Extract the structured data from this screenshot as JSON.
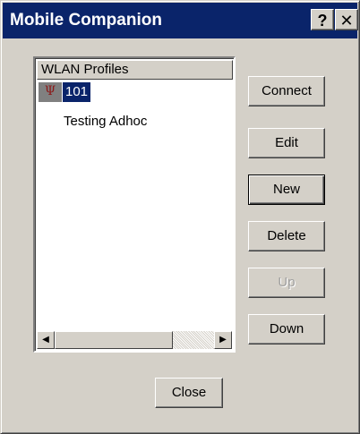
{
  "window": {
    "title": "Mobile Companion",
    "help_label": "?",
    "close_label": "✕"
  },
  "profiles": {
    "header": "WLAN Profiles",
    "items": [
      {
        "label": "101",
        "selected": true,
        "icon": "antenna-icon",
        "icon_glyph": "Ψ"
      },
      {
        "label": "Testing Adhoc",
        "selected": false
      }
    ]
  },
  "scrollbar": {
    "left_arrow": "◀",
    "right_arrow": "▶"
  },
  "buttons": {
    "connect": "Connect",
    "edit": "Edit",
    "new": "New",
    "delete": "Delete",
    "up": "Up",
    "down": "Down",
    "close": "Close"
  },
  "colors": {
    "titlebar": "#0a246a",
    "face": "#d4d0c8",
    "selection": "#0a246a",
    "disabled_text": "#a0a0a0"
  }
}
